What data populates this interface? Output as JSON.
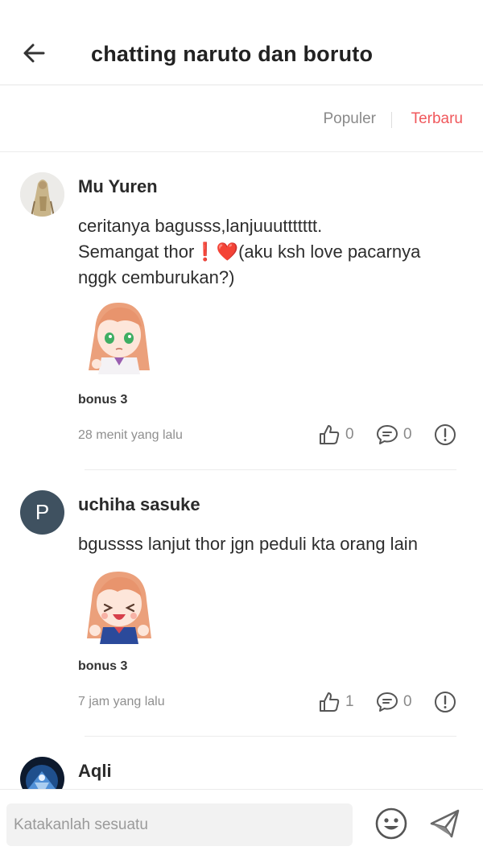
{
  "header": {
    "title": "chatting naruto dan boruto",
    "back_icon": "arrow-left-icon"
  },
  "sort": {
    "popular_label": "Populer",
    "latest_label": "Terbaru",
    "active": "latest",
    "active_color": "#f0585c"
  },
  "comments": [
    {
      "username": "Mu Yuren",
      "avatar_type": "image",
      "text": "ceritanya bagusss,lanjuuuttttttt.\nSemangat thor❗❤️(aku ksh love pacarnya nggk cemburukan?)",
      "sticker_label": "bonus 3",
      "time": "28 menit yang lalu",
      "likes": "0",
      "replies": "0"
    },
    {
      "username": "uchiha sasuke",
      "avatar_type": "letter",
      "avatar_letter": "P",
      "text": "bgussss lanjut thor jgn peduli kta orang lain",
      "sticker_label": "bonus 3",
      "time": "7 jam yang lalu",
      "likes": "1",
      "replies": "0"
    },
    {
      "username": "Aqli",
      "avatar_type": "image"
    }
  ],
  "composer": {
    "placeholder": "Katakanlah sesuatu",
    "emoji_icon": "smiley-icon",
    "send_icon": "send-icon"
  }
}
